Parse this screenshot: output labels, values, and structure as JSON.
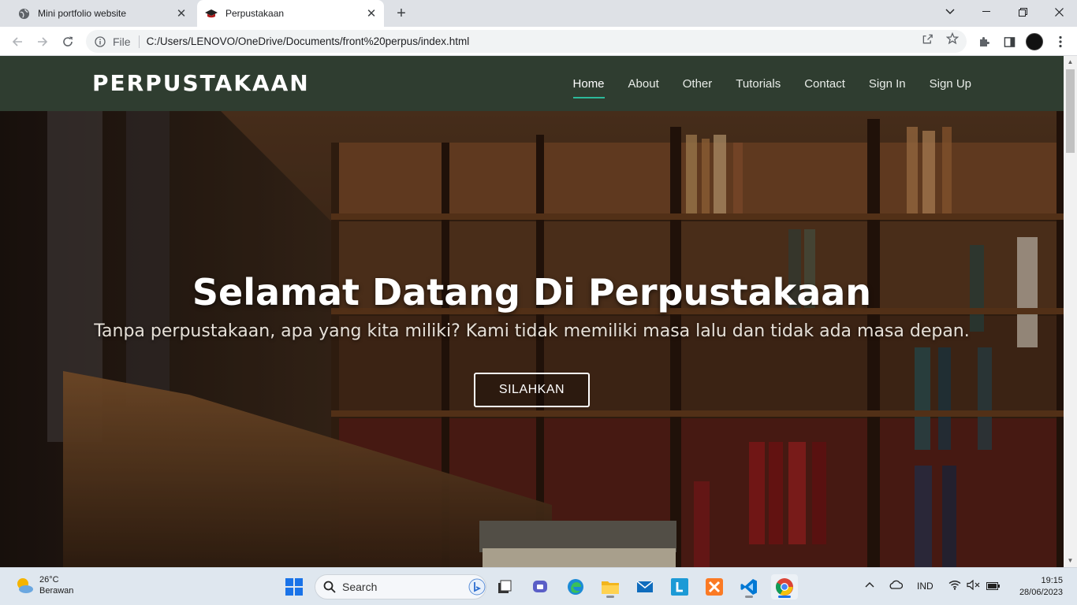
{
  "browser": {
    "tabs": [
      {
        "title": "Mini portfolio website",
        "active": false,
        "icon": "globe-icon"
      },
      {
        "title": "Perpustakaan",
        "active": true,
        "icon": "graduation-cap-icon"
      }
    ],
    "address": {
      "chip": "File",
      "url": "C:/Users/LENOVO/OneDrive/Documents/front%20perpus/index.html"
    }
  },
  "page": {
    "brand": "PERPUSTAKAAN",
    "nav": [
      {
        "label": "Home",
        "active": true
      },
      {
        "label": "About"
      },
      {
        "label": "Other"
      },
      {
        "label": "Tutorials"
      },
      {
        "label": "Contact"
      },
      {
        "label": "Sign In"
      },
      {
        "label": "Sign Up"
      }
    ],
    "hero": {
      "title": "Selamat Datang Di Perpustakaan",
      "subtitle": "Tanpa perpustakaan, apa yang kita miliki? Kami tidak memiliki masa lalu dan tidak ada masa depan.",
      "button": "SILAHKAN"
    },
    "colors": {
      "navbar": "#2f3d30",
      "accent": "#2cb99a"
    }
  },
  "taskbar": {
    "weather": {
      "temp": "26°C",
      "condition": "Berawan"
    },
    "search_label": "Search",
    "tray": {
      "language": "IND"
    },
    "clock": {
      "time": "19:15",
      "date": "28/06/2023"
    }
  }
}
